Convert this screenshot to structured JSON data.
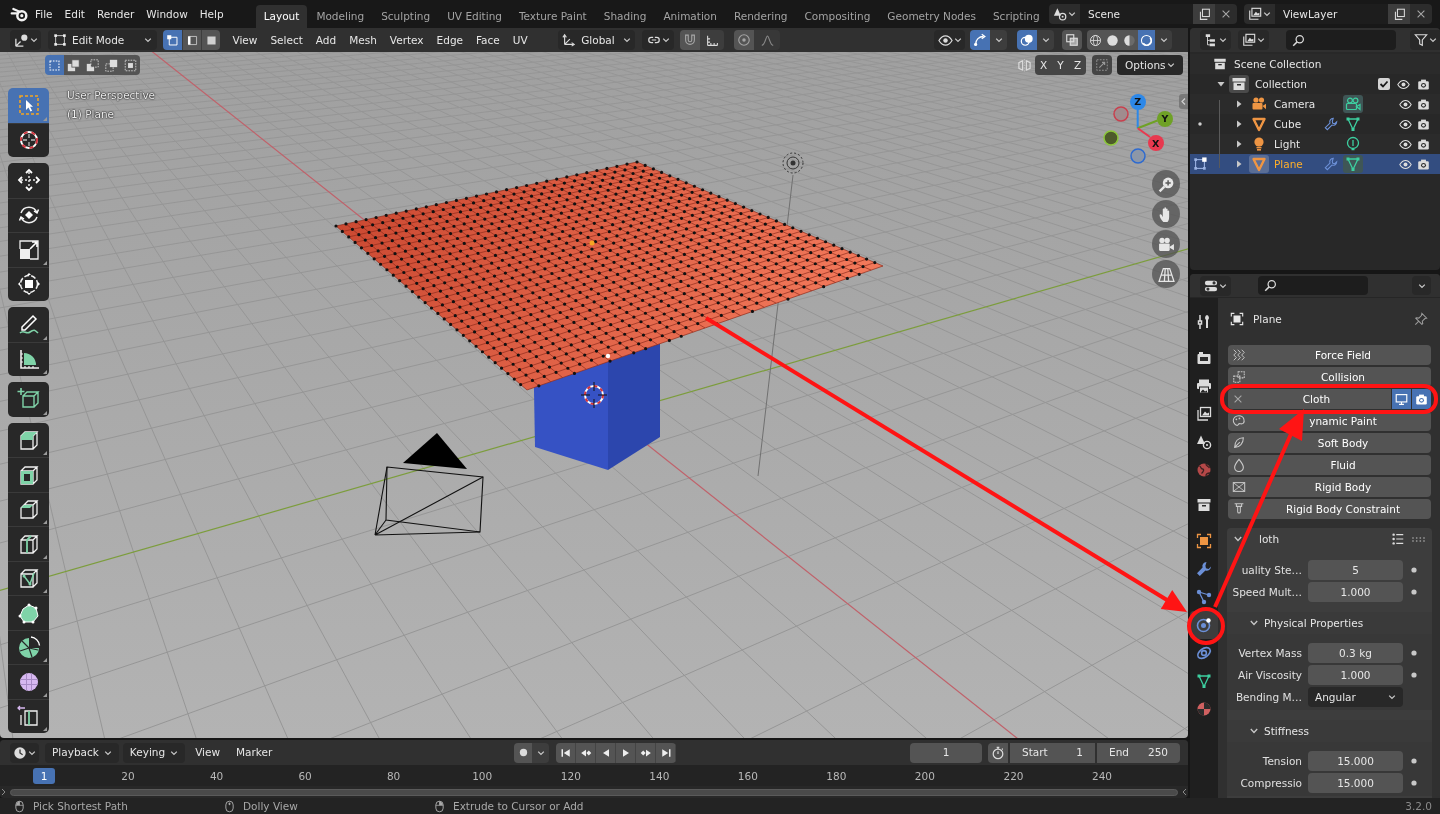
{
  "topbar": {
    "menus": [
      "File",
      "Edit",
      "Render",
      "Window",
      "Help"
    ],
    "workspaces": [
      {
        "label": "Layout",
        "selected": true
      },
      {
        "label": "Modeling",
        "selected": false
      },
      {
        "label": "Sculpting",
        "selected": false
      },
      {
        "label": "UV Editing",
        "selected": false
      },
      {
        "label": "Texture Paint",
        "selected": false
      },
      {
        "label": "Shading",
        "selected": false
      },
      {
        "label": "Animation",
        "selected": false
      },
      {
        "label": "Rendering",
        "selected": false
      },
      {
        "label": "Compositing",
        "selected": false
      },
      {
        "label": "Geometry Nodes",
        "selected": false
      },
      {
        "label": "Scripting",
        "selected": false
      }
    ],
    "scene": "Scene",
    "view_layer": "ViewLayer"
  },
  "viewport_header": {
    "mode": "Edit Mode",
    "select_modes": [
      {
        "selected": true
      },
      {
        "selected": false
      },
      {
        "selected": false
      }
    ],
    "menus": [
      "View",
      "Select",
      "Add",
      "Mesh",
      "Vertex",
      "Edge",
      "Face",
      "UV"
    ],
    "orientation": "Global",
    "snap": {
      "on": false
    },
    "proportional_editing": {
      "on": false
    },
    "gizmos": {
      "on": true
    },
    "overlays": {
      "on": true
    },
    "xray": {
      "on": false
    },
    "shading_modes": [
      {
        "selected": false
      },
      {
        "selected": false
      },
      {
        "selected": false
      },
      {
        "selected": true
      }
    ]
  },
  "tool_settings": {
    "select_box_modes": [
      {
        "selected": true
      },
      {
        "selected": false
      },
      {
        "selected": false
      },
      {
        "selected": false
      },
      {
        "selected": false
      }
    ],
    "mirror_axes": [
      {
        "label": "X",
        "on": false
      },
      {
        "label": "Y",
        "on": false
      },
      {
        "label": "Z",
        "on": false
      }
    ],
    "options": "Options"
  },
  "viewport": {
    "view_name": "User Perspective",
    "active_object": "(1) Plane",
    "gizmo_axes": [
      "Z",
      "Y",
      "X"
    ]
  },
  "toolbar": {
    "groups": [
      [
        {
          "selected": true
        },
        {
          "selected": false
        }
      ],
      [
        {
          "selected": false
        },
        {
          "selected": false
        },
        {
          "selected": false
        },
        {
          "selected": false
        }
      ],
      [
        {
          "selected": false
        },
        {
          "selected": false
        }
      ],
      [
        {
          "selected": false
        }
      ],
      [
        {
          "selected": false
        },
        {
          "selected": false
        },
        {
          "selected": false
        },
        {
          "selected": false
        },
        {
          "selected": false
        },
        {
          "selected": false
        },
        {
          "selected": false
        },
        {
          "selected": false
        },
        {
          "selected": false
        }
      ]
    ]
  },
  "outliner": {
    "root": "Scene Collection",
    "collections": [
      {
        "label": "Collection",
        "expanded": true,
        "checked": true,
        "children": [
          {
            "label": "Camera",
            "kind": "camera",
            "selected": false,
            "expanded": false,
            "modifier": false,
            "data_active": true,
            "edit_mode": false
          },
          {
            "label": "Cube",
            "kind": "mesh",
            "selected": false,
            "expanded": false,
            "modifier": true,
            "data_active": false,
            "edit_mode": false
          },
          {
            "label": "Light",
            "kind": "light",
            "selected": false,
            "expanded": false,
            "modifier": false,
            "data_active": false,
            "edit_mode": false
          },
          {
            "label": "Plane",
            "kind": "mesh",
            "selected": true,
            "expanded": false,
            "modifier": true,
            "data_active": true,
            "edit_mode": true
          }
        ]
      }
    ]
  },
  "properties": {
    "tabs": [
      {
        "selected": false
      },
      {
        "selected": false
      },
      {
        "selected": false
      },
      {
        "selected": false
      },
      {
        "selected": false
      },
      {
        "selected": false
      },
      {
        "selected": false
      },
      {
        "selected": false
      },
      {
        "selected": false
      },
      {
        "selected": false
      },
      {
        "selected": true
      },
      {
        "selected": false
      },
      {
        "selected": false
      },
      {
        "selected": false
      }
    ],
    "object_name": "Plane",
    "physics": [
      {
        "label": "Force Field",
        "enabled": false
      },
      {
        "label": "Collision",
        "enabled": false
      },
      {
        "label": "Cloth",
        "enabled": true,
        "viewport": true,
        "render": true
      },
      {
        "label": "ynamic Paint",
        "enabled": false
      },
      {
        "label": "Soft Body",
        "enabled": false
      },
      {
        "label": "Fluid",
        "enabled": false
      },
      {
        "label": "Rigid Body",
        "enabled": false
      },
      {
        "label": "Rigid Body Constraint",
        "enabled": false
      }
    ],
    "cloth_panel": {
      "title": "loth",
      "expanded": true,
      "fields": [
        {
          "label": "uality Ste…",
          "value": "5",
          "kind": "number"
        },
        {
          "label": "Speed Mult…",
          "value": "1.000",
          "kind": "number"
        }
      ],
      "subpanels": [
        {
          "title": "Physical Properties",
          "expanded": true,
          "fields": [
            {
              "label": "Vertex Mass",
              "value": "0.3 kg",
              "kind": "number"
            },
            {
              "label": "Air Viscosity",
              "value": "1.000",
              "kind": "number"
            },
            {
              "label": "Bending M…",
              "value": "Angular",
              "kind": "dropdown"
            }
          ]
        },
        {
          "title": "Stiffness",
          "expanded": true,
          "fields": [
            {
              "label": "Tension",
              "value": "15.000",
              "kind": "number"
            },
            {
              "label": "Compressio",
              "value": "15.000",
              "kind": "number"
            }
          ]
        }
      ]
    }
  },
  "timeline": {
    "menus": [
      {
        "label": "Playback",
        "kind": "dropdown"
      },
      {
        "label": "Keying",
        "kind": "dropdown"
      },
      {
        "label": "View",
        "kind": "menu"
      },
      {
        "label": "Marker",
        "kind": "menu"
      }
    ],
    "current_frame": "1",
    "start": {
      "label": "Start",
      "value": "1"
    },
    "end": {
      "label": "End",
      "value": "250"
    },
    "playhead": "1",
    "frame_labels": [
      "20",
      "40",
      "60",
      "80",
      "100",
      "120",
      "140",
      "160",
      "180",
      "200",
      "220",
      "240"
    ]
  },
  "status_bar": {
    "hints": [
      "Pick Shortest Path",
      "Dolly View",
      "Extrude to Cursor or Add"
    ],
    "version": "3.2.0"
  }
}
